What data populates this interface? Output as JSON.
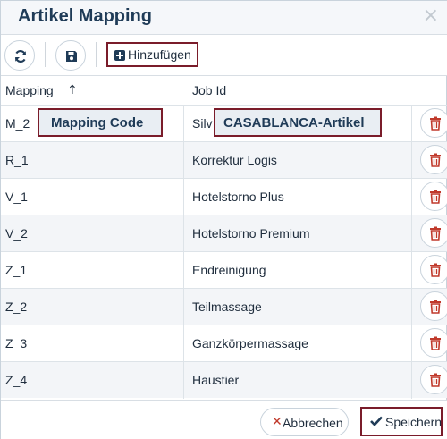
{
  "dialog": {
    "title": "Artikel Mapping",
    "close_glyph": "×"
  },
  "toolbar": {
    "refresh_icon": "refresh-icon",
    "save_icon": "floppy-disk-icon",
    "add_label": "Hinzufügen",
    "add_icon": "plus-square-icon"
  },
  "table": {
    "columns": [
      "Mapping",
      "Job Id"
    ],
    "sort_indicator": "↑",
    "rows": [
      {
        "code": "M_2",
        "job": "Silv"
      },
      {
        "code": "R_1",
        "job": "Korrektur Logis"
      },
      {
        "code": "V_1",
        "job": "Hotelstorno Plus"
      },
      {
        "code": "V_2",
        "job": "Hotelstorno Premium"
      },
      {
        "code": "Z_1",
        "job": "Endreinigung"
      },
      {
        "code": "Z_2",
        "job": "Teilmassage"
      },
      {
        "code": "Z_3",
        "job": "Ganzkörpermassage"
      },
      {
        "code": "Z_4",
        "job": "Haustier"
      }
    ],
    "delete_icon": "trash-icon"
  },
  "callouts": {
    "mapping_code": "Mapping Code",
    "article": "CASABLANCA-Artikel"
  },
  "footer": {
    "cancel_label": "Abbrechen",
    "save_label": "Speichern"
  },
  "colors": {
    "title": "#1f3b57",
    "highlight_border": "#7a1c2a",
    "delete_red": "#c0392b"
  }
}
